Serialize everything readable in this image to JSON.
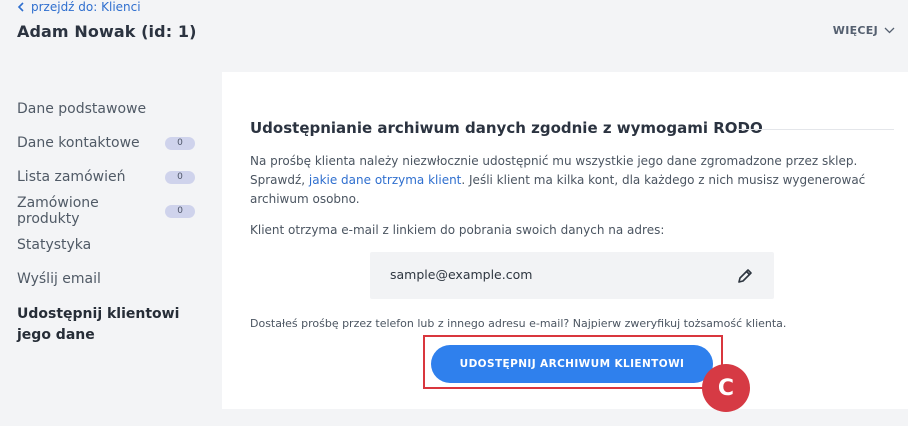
{
  "header": {
    "back_link": "przejdź do: Klienci",
    "title": "Adam Nowak (id: 1)",
    "more_label": "WIĘCEJ"
  },
  "sidebar": {
    "items": [
      {
        "label": "Dane podstawowe",
        "badge": ""
      },
      {
        "label": "Dane kontaktowe",
        "badge": "0"
      },
      {
        "label": "Lista zamówień",
        "badge": "0"
      },
      {
        "label": "Zamówione produkty",
        "badge": "0"
      },
      {
        "label": "Statystyka",
        "badge": ""
      },
      {
        "label": "Wyślij email",
        "badge": ""
      },
      {
        "label": "Udostępnij klientowi jego dane",
        "badge": "",
        "active": true
      }
    ]
  },
  "main": {
    "section_title": "Udostępnianie archiwum danych zgodnie z wymogami RODO",
    "description_part1": "Na prośbę klienta należy niezwłocznie udostępnić mu wszystkie jego dane zgromadzone przez sklep. Sprawdź, ",
    "description_link": "jakie dane otrzyma klient",
    "description_part2": ". Jeśli klient ma kilka kont, dla każdego z nich musisz wygenerować archiwum osobno.",
    "email_info": "Klient otrzyma e-mail z linkiem do pobrania swoich danych na adres:",
    "email_value": "sample@example.com",
    "verify_note": "Dostałeś prośbę przez telefon lub z innego adresu e-mail? Najpierw zweryfikuj tożsamość klienta.",
    "share_button": "UDOSTĘPNIJ ARCHIWUM KLIENTOWI"
  },
  "annotation": {
    "marker_label": "C",
    "color": "#d63a44"
  },
  "colors": {
    "accent": "#2f80ed",
    "link": "#2f6fcf",
    "badge": "#cfd3ec",
    "highlight": "#d9363e"
  }
}
